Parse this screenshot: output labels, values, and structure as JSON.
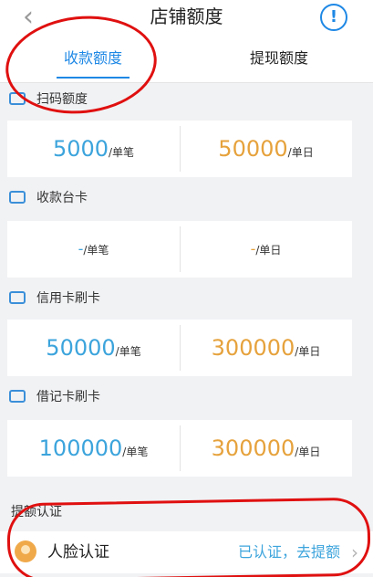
{
  "header": {
    "title": "店铺额度",
    "back_icon": "chevron-left-icon",
    "info_icon": "info-circle-icon",
    "info_glyph": "!"
  },
  "tabs": [
    {
      "label": "收款额度",
      "active": true
    },
    {
      "label": "提现额度",
      "active": false
    }
  ],
  "sections": [
    {
      "label": "扫码额度",
      "icon": "scan-icon",
      "per_txn": "5000",
      "per_txn_unit": "/单笔",
      "per_day": "50000",
      "per_day_unit": "/单日"
    },
    {
      "label": "收款台卡",
      "icon": "qr-card-icon",
      "per_txn": "-",
      "per_txn_unit": "/单笔",
      "per_day": "-",
      "per_day_unit": "/单日"
    },
    {
      "label": "信用卡刷卡",
      "icon": "credit-card-icon",
      "per_txn": "50000",
      "per_txn_unit": "/单笔",
      "per_day": "300000",
      "per_day_unit": "/单日"
    },
    {
      "label": "借记卡刷卡",
      "icon": "debit-card-icon",
      "per_txn": "100000",
      "per_txn_unit": "/单笔",
      "per_day": "300000",
      "per_day_unit": "/单日"
    }
  ],
  "verify": {
    "section_label": "提额认证",
    "item_label": "人脸认证",
    "status": "已认证，去提额",
    "icon": "face-icon"
  },
  "colors": {
    "accent_blue": "#1e88e5",
    "value_blue": "#3ca4dc",
    "value_orange": "#e6a23c",
    "annotation_red": "#e01010"
  }
}
